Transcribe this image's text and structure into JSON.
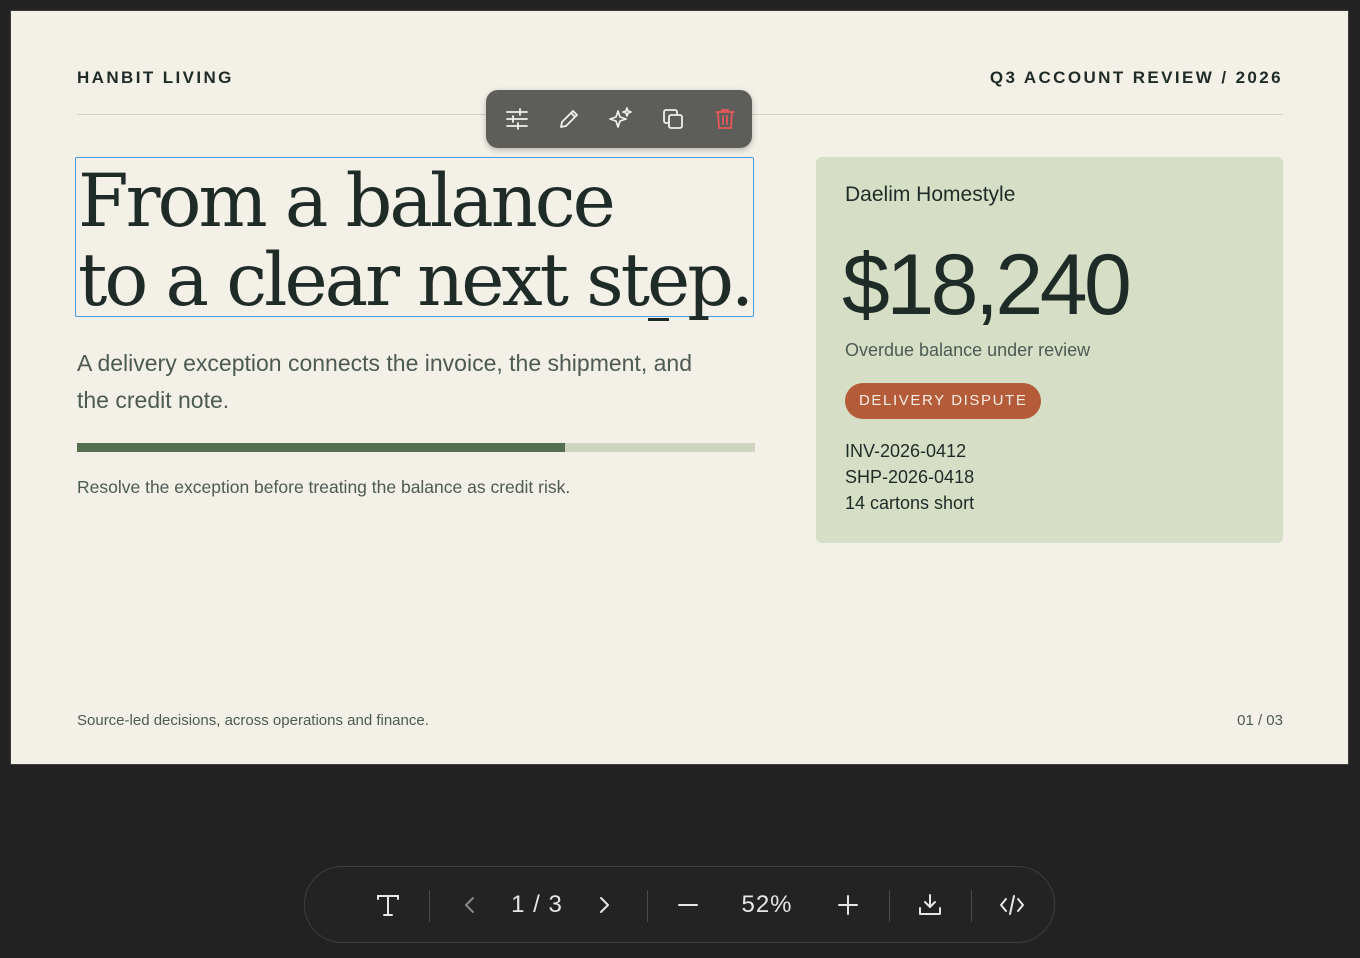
{
  "slide": {
    "brand": "HANBIT LIVING",
    "review": "Q3 ACCOUNT REVIEW / 2026",
    "headline": {
      "line1": "From a balance",
      "line2": "to a clear next step."
    },
    "subhead": "A delivery exception connects the invoice, the shipment, and the credit note.",
    "progress": {
      "value": 0.72,
      "color": "#566e50"
    },
    "note": "Resolve the exception before treating the balance as credit risk.",
    "card": {
      "company": "Daelim Homestyle",
      "amount": "$18,240",
      "amount_label": "Overdue balance under review",
      "badge": "DELIVERY DISPUTE",
      "badge_color": "#b45b3a",
      "refs": [
        "INV-2026-0412",
        "SHP-2026-0418",
        "14 cartons short"
      ]
    },
    "footer_left": "Source-led decisions, across operations and finance.",
    "footer_right": "01 / 03"
  },
  "element_toolbar": {
    "icons": [
      "sliders-icon",
      "pencil-icon",
      "sparkle-icon",
      "duplicate-icon",
      "trash-icon"
    ],
    "delete_color": "#e8585a"
  },
  "bottom_toolbar": {
    "page": "1 / 3",
    "zoom": "52%"
  },
  "colors": {
    "background": "#222222",
    "slide_bg": "#f2f0e7",
    "card_bg": "#d6dfc6",
    "selection": "#4a9ae0",
    "ink": "#1f2b27"
  }
}
